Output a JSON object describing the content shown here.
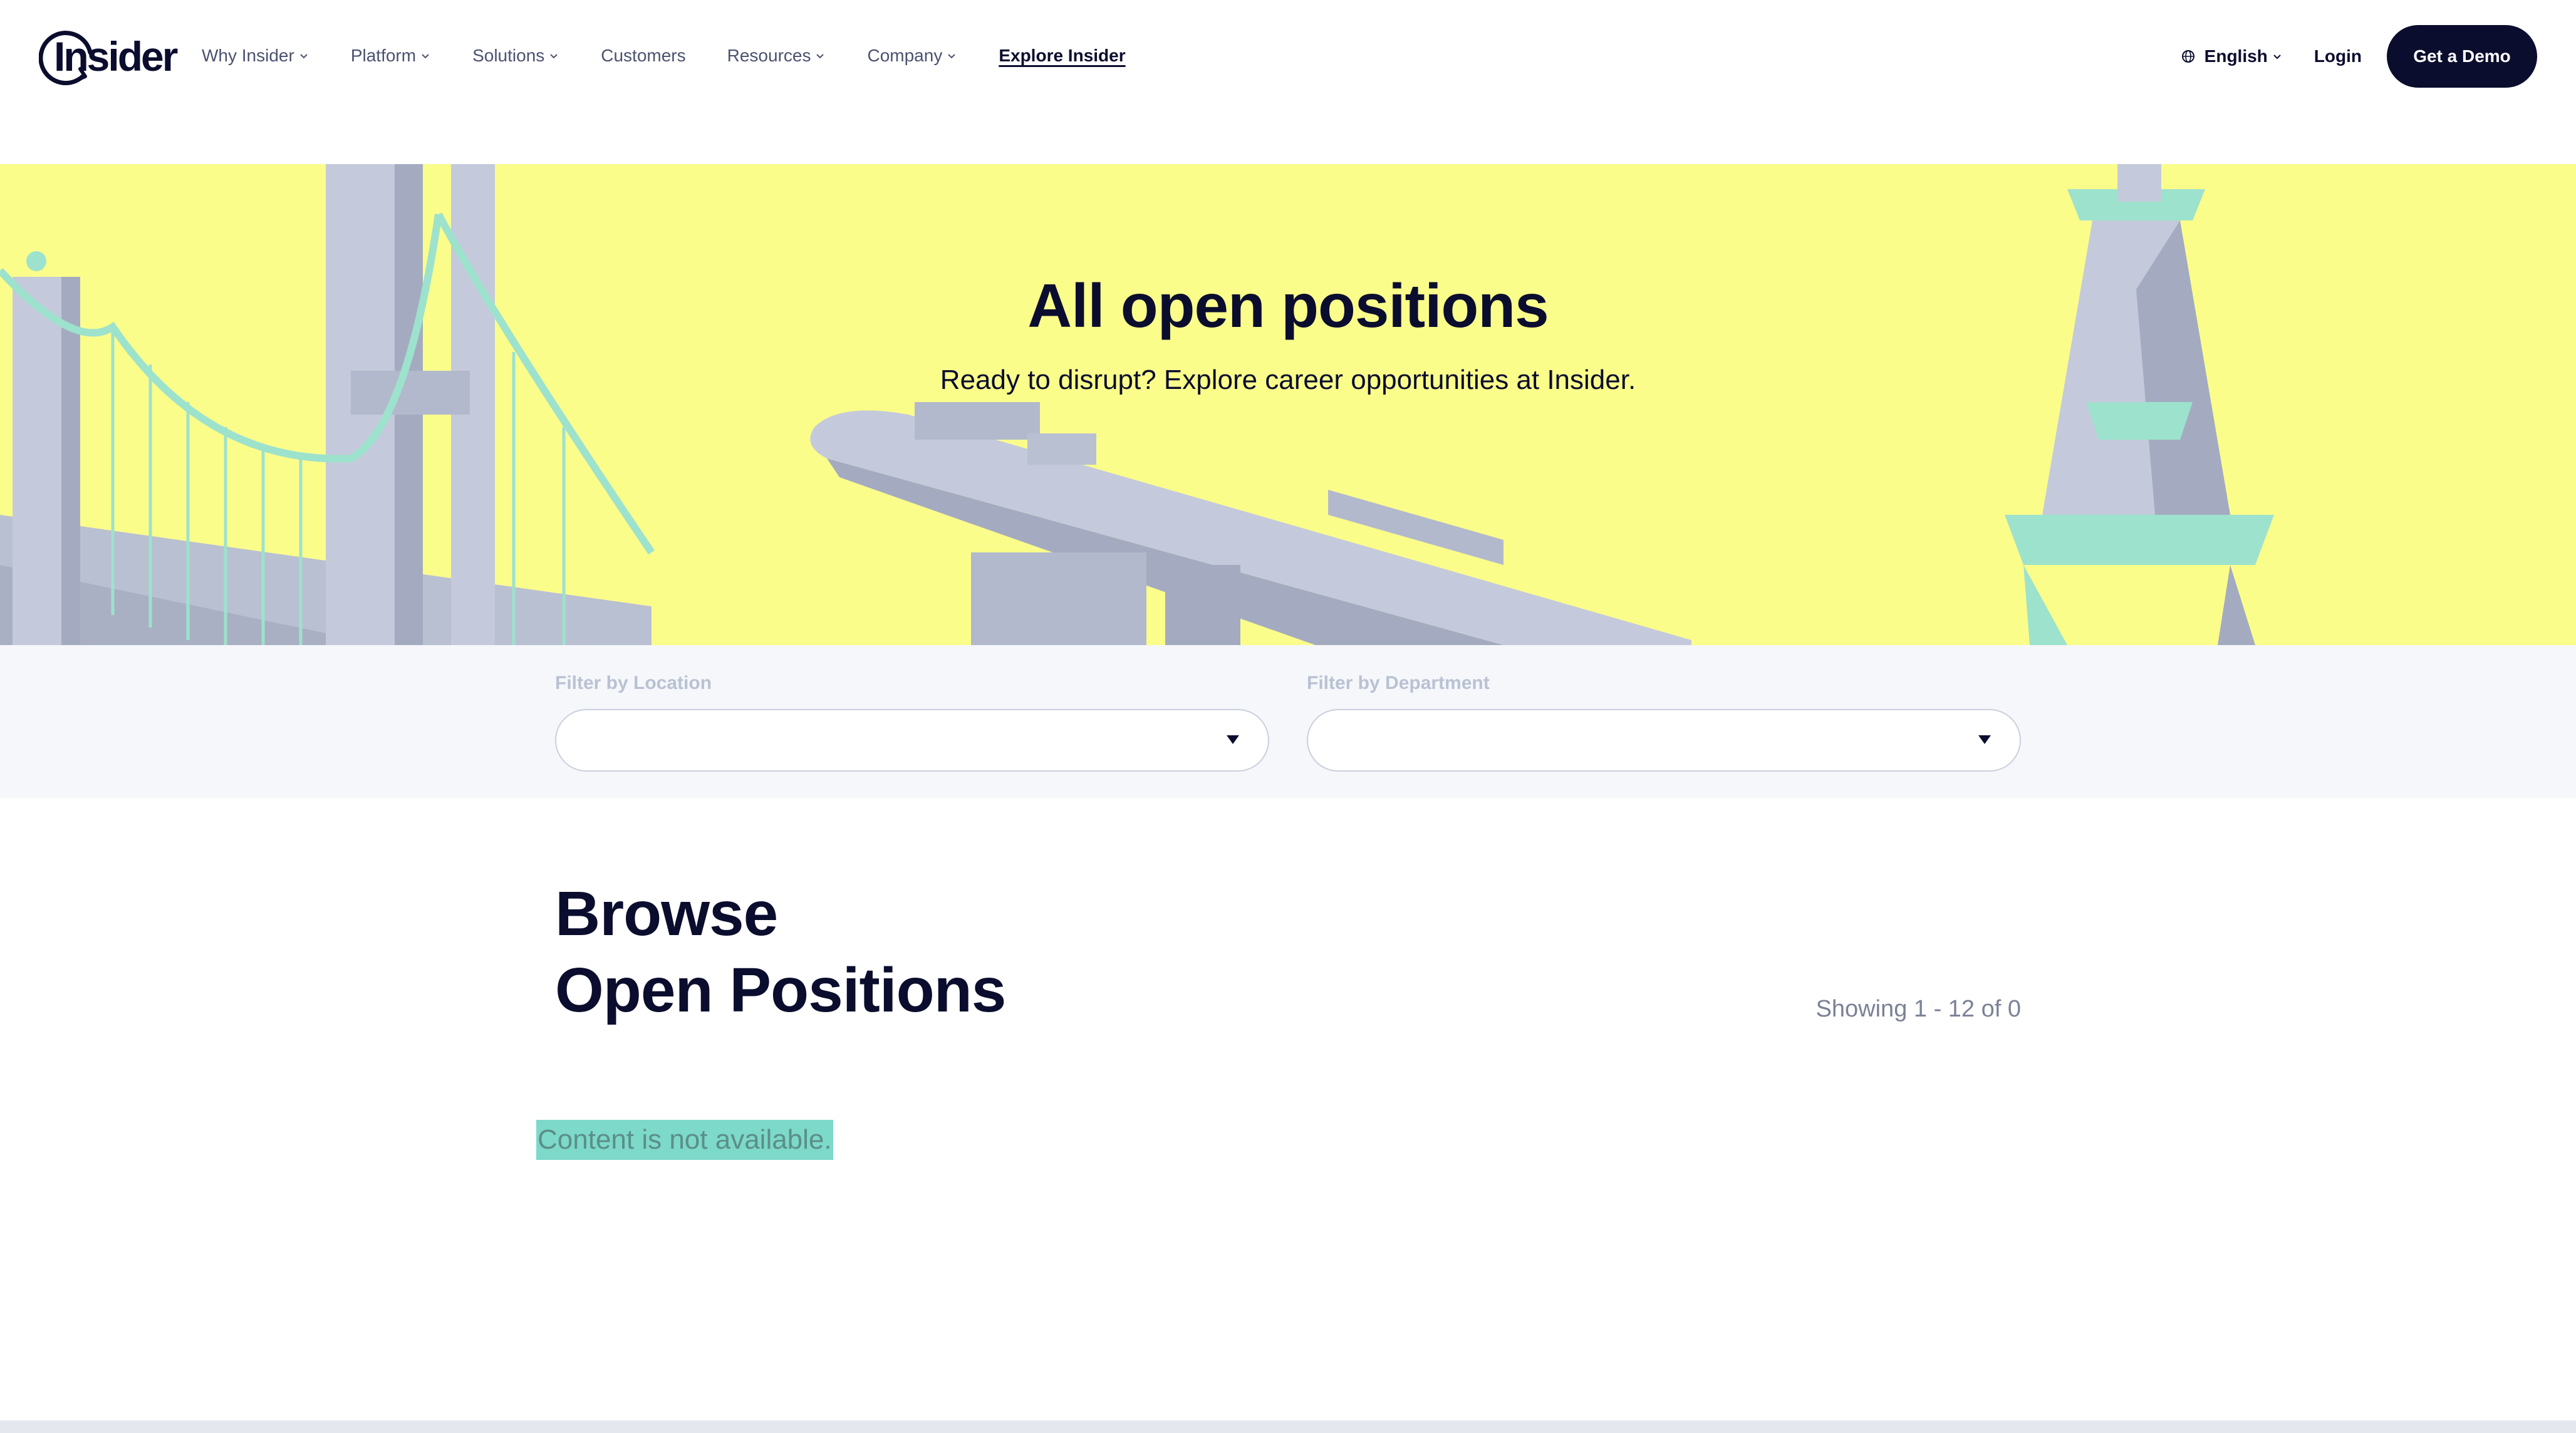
{
  "header": {
    "logo_text": "Insider",
    "nav": [
      {
        "label": "Why Insider",
        "has_dropdown": true
      },
      {
        "label": "Platform",
        "has_dropdown": true
      },
      {
        "label": "Solutions",
        "has_dropdown": true
      },
      {
        "label": "Customers",
        "has_dropdown": false
      },
      {
        "label": "Resources",
        "has_dropdown": true
      },
      {
        "label": "Company",
        "has_dropdown": true
      }
    ],
    "explore_label": "Explore Insider",
    "language": "English",
    "login_label": "Login",
    "demo_label": "Get a Demo"
  },
  "hero": {
    "title": "All open positions",
    "subtitle": "Ready to disrupt? Explore career opportunities at Insider."
  },
  "filters": {
    "location_label": "Filter by Location",
    "location_value": "",
    "department_label": "Filter by Department",
    "department_value": ""
  },
  "main": {
    "browse_line1": "Browse",
    "browse_line2": "Open Positions",
    "showing_text": "Showing 1 - 12 of 0",
    "empty_text": "Content is not available."
  },
  "colors": {
    "navy": "#0b0d2e",
    "hero_yellow": "#fbfd8b",
    "mint": "#9de2cc",
    "highlight": "#7dd9c9"
  }
}
